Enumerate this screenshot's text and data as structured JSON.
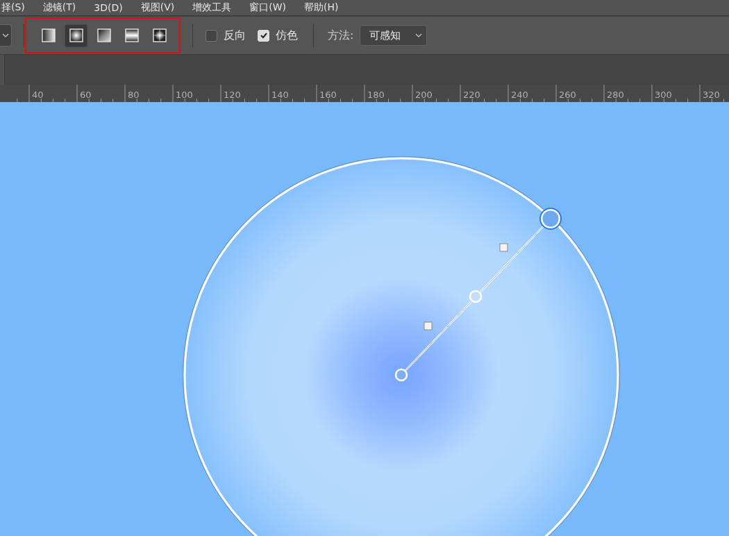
{
  "menu": [
    "择(S)",
    "滤镜(T)",
    "3D(D)",
    "视图(V)",
    "增效工具",
    "窗口(W)",
    "帮助(H)"
  ],
  "toolbar": {
    "gradient_types": [
      {
        "kind": "linear",
        "selected": false
      },
      {
        "kind": "radial",
        "selected": true
      },
      {
        "kind": "angle",
        "selected": false
      },
      {
        "kind": "reflected",
        "selected": false
      },
      {
        "kind": "diamond",
        "selected": false
      }
    ],
    "reverse": {
      "label": "反向",
      "checked": false
    },
    "dither": {
      "label": "仿色",
      "checked": true
    },
    "method": {
      "label": "方法:",
      "value": "可感知"
    }
  },
  "ruler": [
    "40",
    "60",
    "80",
    "100",
    "120",
    "140",
    "160",
    "180",
    "200",
    "220",
    "240",
    "260",
    "280",
    "300",
    "320"
  ]
}
